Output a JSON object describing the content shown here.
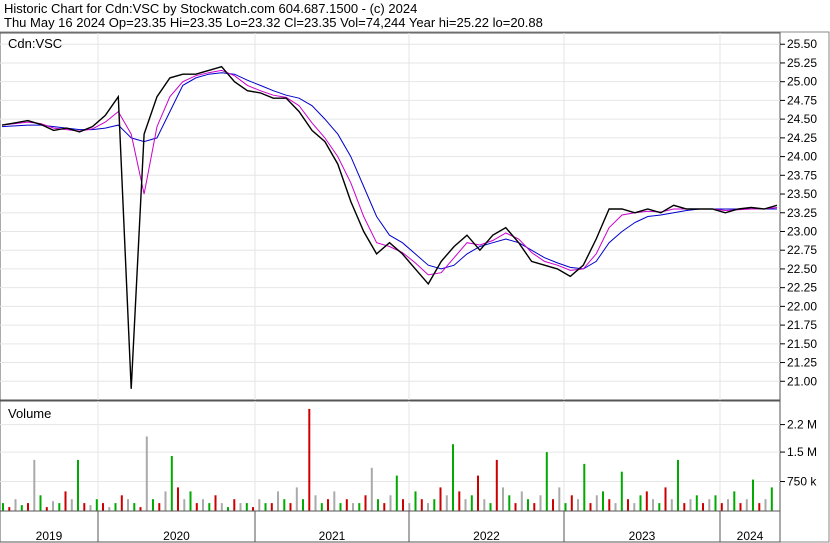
{
  "header": {
    "line1": "Historic Chart for Cdn:VSC by Stockwatch.com 604.687.1500 - (c) 2024",
    "line2": "Thu May 16 2024   Op=23.35   Hi=23.35   Lo=23.32   Cl=23.35   Vol=74,244   Year hi=25.22   lo=20.88"
  },
  "price_panel": {
    "label": "Cdn:VSC"
  },
  "volume_panel": {
    "label": "Volume"
  },
  "chart_data": [
    {
      "type": "line",
      "ylim": [
        20.75,
        25.65
      ],
      "yticks": [
        "25.50",
        "25.25",
        "25.00",
        "24.75",
        "24.50",
        "24.25",
        "24.00",
        "23.75",
        "23.50",
        "23.25",
        "23.00",
        "22.75",
        "22.50",
        "22.25",
        "22.00",
        "21.75",
        "21.50",
        "21.25",
        "21.00"
      ],
      "xticks": [
        "2019",
        "2020",
        "2021",
        "2022",
        "2023",
        "2024"
      ],
      "colors": {
        "price": "#000000",
        "ma_short": "#cc00cc",
        "ma_long": "#0000cc"
      },
      "x": [
        "2019-06",
        "2019-07",
        "2019-08",
        "2019-09",
        "2019-10",
        "2019-11",
        "2019-12",
        "2020-01",
        "2020-02",
        "2020-03",
        "2020-03b",
        "2020-04",
        "2020-05",
        "2020-06",
        "2020-07",
        "2020-08",
        "2020-09",
        "2020-10",
        "2020-11",
        "2020-12",
        "2021-01",
        "2021-02",
        "2021-03",
        "2021-04",
        "2021-05",
        "2021-06",
        "2021-07",
        "2021-08",
        "2021-09",
        "2021-10",
        "2021-11",
        "2021-12",
        "2022-01",
        "2022-02",
        "2022-03",
        "2022-04",
        "2022-05",
        "2022-06",
        "2022-07",
        "2022-08",
        "2022-09",
        "2022-10",
        "2022-11",
        "2022-12",
        "2023-01",
        "2023-02",
        "2023-03",
        "2023-04",
        "2023-05",
        "2023-06",
        "2023-07",
        "2023-08",
        "2023-09",
        "2023-10",
        "2023-11",
        "2023-12",
        "2024-01",
        "2024-02",
        "2024-03",
        "2024-04",
        "2024-05"
      ],
      "series": [
        {
          "values": [
            24.42,
            24.45,
            24.48,
            24.43,
            24.35,
            24.38,
            24.33,
            24.4,
            24.55,
            24.8,
            20.9,
            24.3,
            24.8,
            25.05,
            25.1,
            25.1,
            25.15,
            25.2,
            25.0,
            24.88,
            24.85,
            24.78,
            24.78,
            24.6,
            24.35,
            24.2,
            23.9,
            23.4,
            23.0,
            22.7,
            22.85,
            22.7,
            22.5,
            22.3,
            22.6,
            22.8,
            22.95,
            22.75,
            22.95,
            23.05,
            22.85,
            22.6,
            22.55,
            22.5,
            22.4,
            22.55,
            22.9,
            23.3,
            23.3,
            23.25,
            23.3,
            23.25,
            23.35,
            23.3,
            23.3,
            23.3,
            23.25,
            23.3,
            23.32,
            23.3,
            23.35
          ]
        },
        {
          "values": [
            24.42,
            24.44,
            24.46,
            24.44,
            24.38,
            24.36,
            24.34,
            24.37,
            24.46,
            24.6,
            24.3,
            23.5,
            24.4,
            24.8,
            25.0,
            25.08,
            25.12,
            25.15,
            25.08,
            24.95,
            24.88,
            24.82,
            24.79,
            24.68,
            24.45,
            24.25,
            24.0,
            23.65,
            23.2,
            22.85,
            22.8,
            22.72,
            22.58,
            22.42,
            22.45,
            22.65,
            22.85,
            22.82,
            22.88,
            22.98,
            22.9,
            22.72,
            22.6,
            22.55,
            22.48,
            22.5,
            22.7,
            23.05,
            23.22,
            23.25,
            23.27,
            23.26,
            23.3,
            23.3,
            23.3,
            23.3,
            23.28,
            23.29,
            23.3,
            23.3,
            23.32
          ]
        },
        {
          "values": [
            24.4,
            24.41,
            24.42,
            24.42,
            24.4,
            24.38,
            24.36,
            24.36,
            24.38,
            24.42,
            24.25,
            24.2,
            24.25,
            24.6,
            24.95,
            25.05,
            25.1,
            25.12,
            25.1,
            25.02,
            24.95,
            24.88,
            24.82,
            24.78,
            24.68,
            24.5,
            24.3,
            24.0,
            23.6,
            23.2,
            22.95,
            22.85,
            22.7,
            22.55,
            22.5,
            22.55,
            22.7,
            22.8,
            22.85,
            22.9,
            22.85,
            22.75,
            22.65,
            22.58,
            22.52,
            22.5,
            22.6,
            22.85,
            23.0,
            23.12,
            23.2,
            23.22,
            23.25,
            23.28,
            23.3,
            23.3,
            23.3,
            23.3,
            23.3,
            23.3,
            23.3
          ]
        }
      ]
    },
    {
      "type": "bar",
      "yticks": [
        "2.2 M",
        "1.5 M",
        "750 k"
      ],
      "ylim": [
        0,
        2.8
      ],
      "colors": {
        "up": "#00aa00",
        "down": "#cc0000",
        "flat": "#aaaaaa"
      },
      "values": [
        0.2,
        0.1,
        0.3,
        0.15,
        0.2,
        1.3,
        0.4,
        0.1,
        0.25,
        0.2,
        0.5,
        0.3,
        1.3,
        0.2,
        0.15,
        0.3,
        0.2,
        0.1,
        0.2,
        0.4,
        0.3,
        0.2,
        0.1,
        1.9,
        0.3,
        0.2,
        0.5,
        1.4,
        0.6,
        0.3,
        0.5,
        0.2,
        0.3,
        0.2,
        0.4,
        0.2,
        0.1,
        0.3,
        0.2,
        0.2,
        0.1,
        0.3,
        0.2,
        0.2,
        0.5,
        0.3,
        0.2,
        0.6,
        0.3,
        2.6,
        0.4,
        0.2,
        0.3,
        0.5,
        0.2,
        0.3,
        0.2,
        0.2,
        0.4,
        1.1,
        0.3,
        0.2,
        0.4,
        0.9,
        0.3,
        0.2,
        0.5,
        0.3,
        0.2,
        0.3,
        0.6,
        0.4,
        1.7,
        0.5,
        0.3,
        0.4,
        0.9,
        0.3,
        0.2,
        1.3,
        0.6,
        0.4,
        0.2,
        0.5,
        0.3,
        0.2,
        0.4,
        1.5,
        0.3,
        0.6,
        0.2,
        0.4,
        0.3,
        1.2,
        0.2,
        0.4,
        0.5,
        0.3,
        0.2,
        1.0,
        0.3,
        0.2,
        0.4,
        0.5,
        0.3,
        0.2,
        0.6,
        0.3,
        1.3,
        0.2,
        0.3,
        0.4,
        0.2,
        0.3,
        0.4,
        0.2,
        0.3,
        0.5,
        0.2,
        0.3,
        0.8,
        0.2,
        0.3,
        0.6
      ]
    }
  ]
}
